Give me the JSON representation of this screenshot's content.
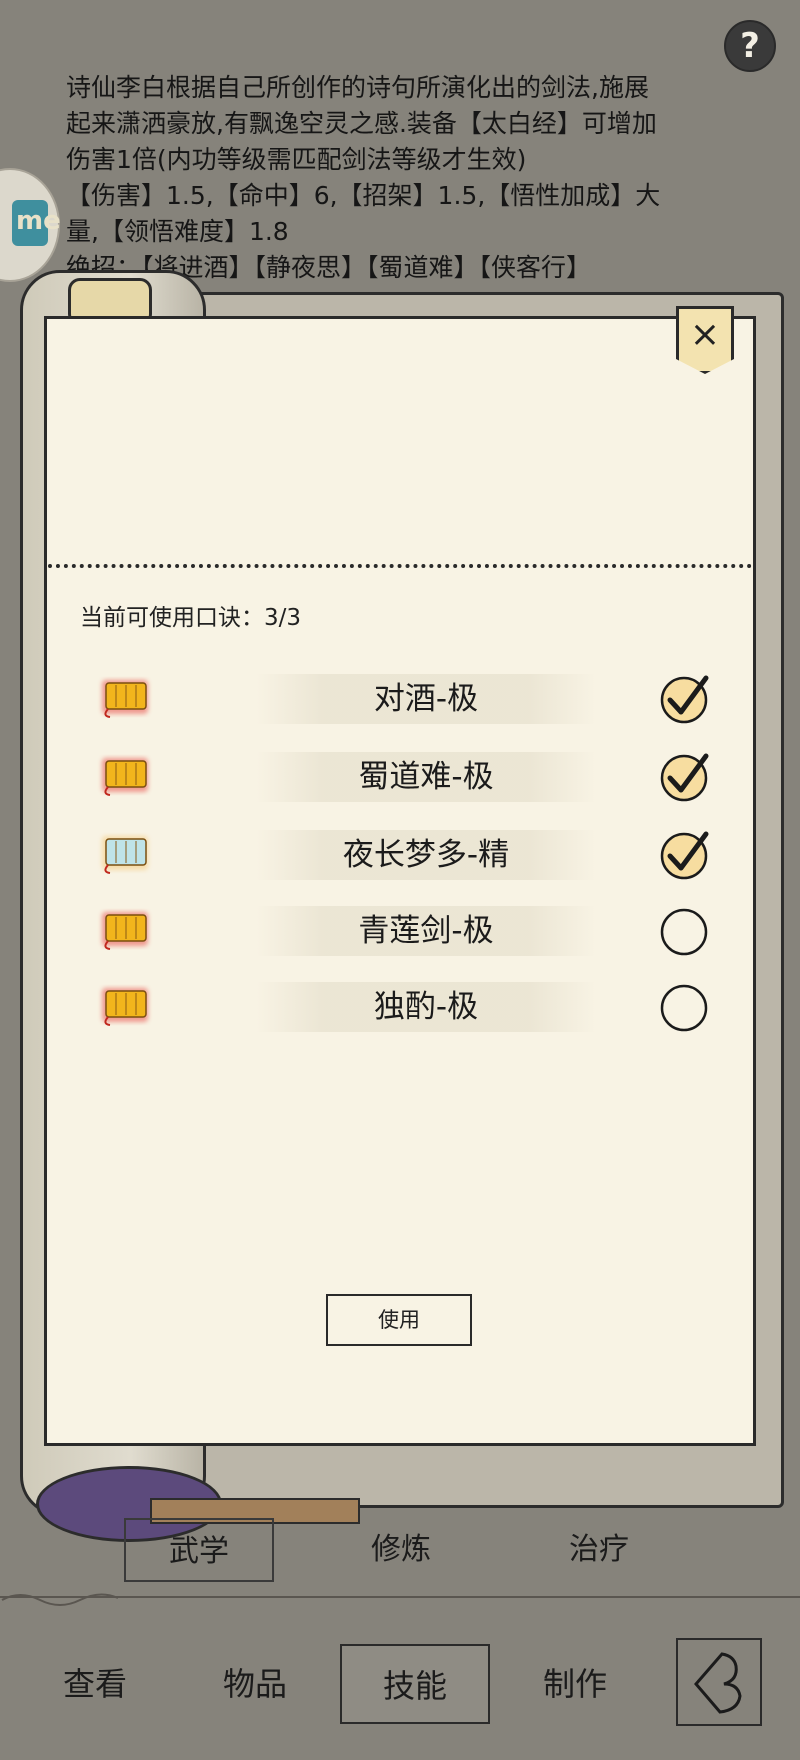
{
  "help": {
    "label": "?"
  },
  "description": {
    "line1": "诗仙李白根据自己所创作的诗句所演化出的剑法,施展",
    "line2": "起来潇洒豪放,有飘逸空灵之感.装备【太白经】可增加",
    "line3": "伤害1倍(内功等级需匹配剑法等级才生效)",
    "line4": "【伤害】1.5,【命中】6,【招架】1.5,【悟性加成】大",
    "line5": "量,【领悟难度】1.8",
    "line6": "绝招：【将进酒】【静夜思】【蜀道难】【侠客行】"
  },
  "side_bubble": {
    "label": "me"
  },
  "panel": {
    "close_label": "×",
    "count_label": "当前可使用口诀：3/3",
    "items": [
      {
        "name": "对酒-极",
        "checked": true,
        "tier": "gold"
      },
      {
        "name": "蜀道难-极",
        "checked": true,
        "tier": "gold"
      },
      {
        "name": "夜长梦多-精",
        "checked": true,
        "tier": "blue"
      },
      {
        "name": "青莲剑-极",
        "checked": false,
        "tier": "gold"
      },
      {
        "name": "独酌-极",
        "checked": false,
        "tier": "gold"
      }
    ],
    "use_button": "使用"
  },
  "subtabs": [
    {
      "label": "武学",
      "active": true
    },
    {
      "label": "修炼",
      "active": false
    },
    {
      "label": "治疗",
      "active": false
    }
  ],
  "bottom_nav": [
    {
      "label": "查看",
      "active": false
    },
    {
      "label": "物品",
      "active": false
    },
    {
      "label": "技能",
      "active": true
    },
    {
      "label": "制作",
      "active": false
    }
  ],
  "colors": {
    "background": "#86837b",
    "panel": "#f8f3e4",
    "scroll_gold": "#f2b51c",
    "scroll_blue": "#bfe3e8",
    "glow_red": "#e8504a"
  }
}
